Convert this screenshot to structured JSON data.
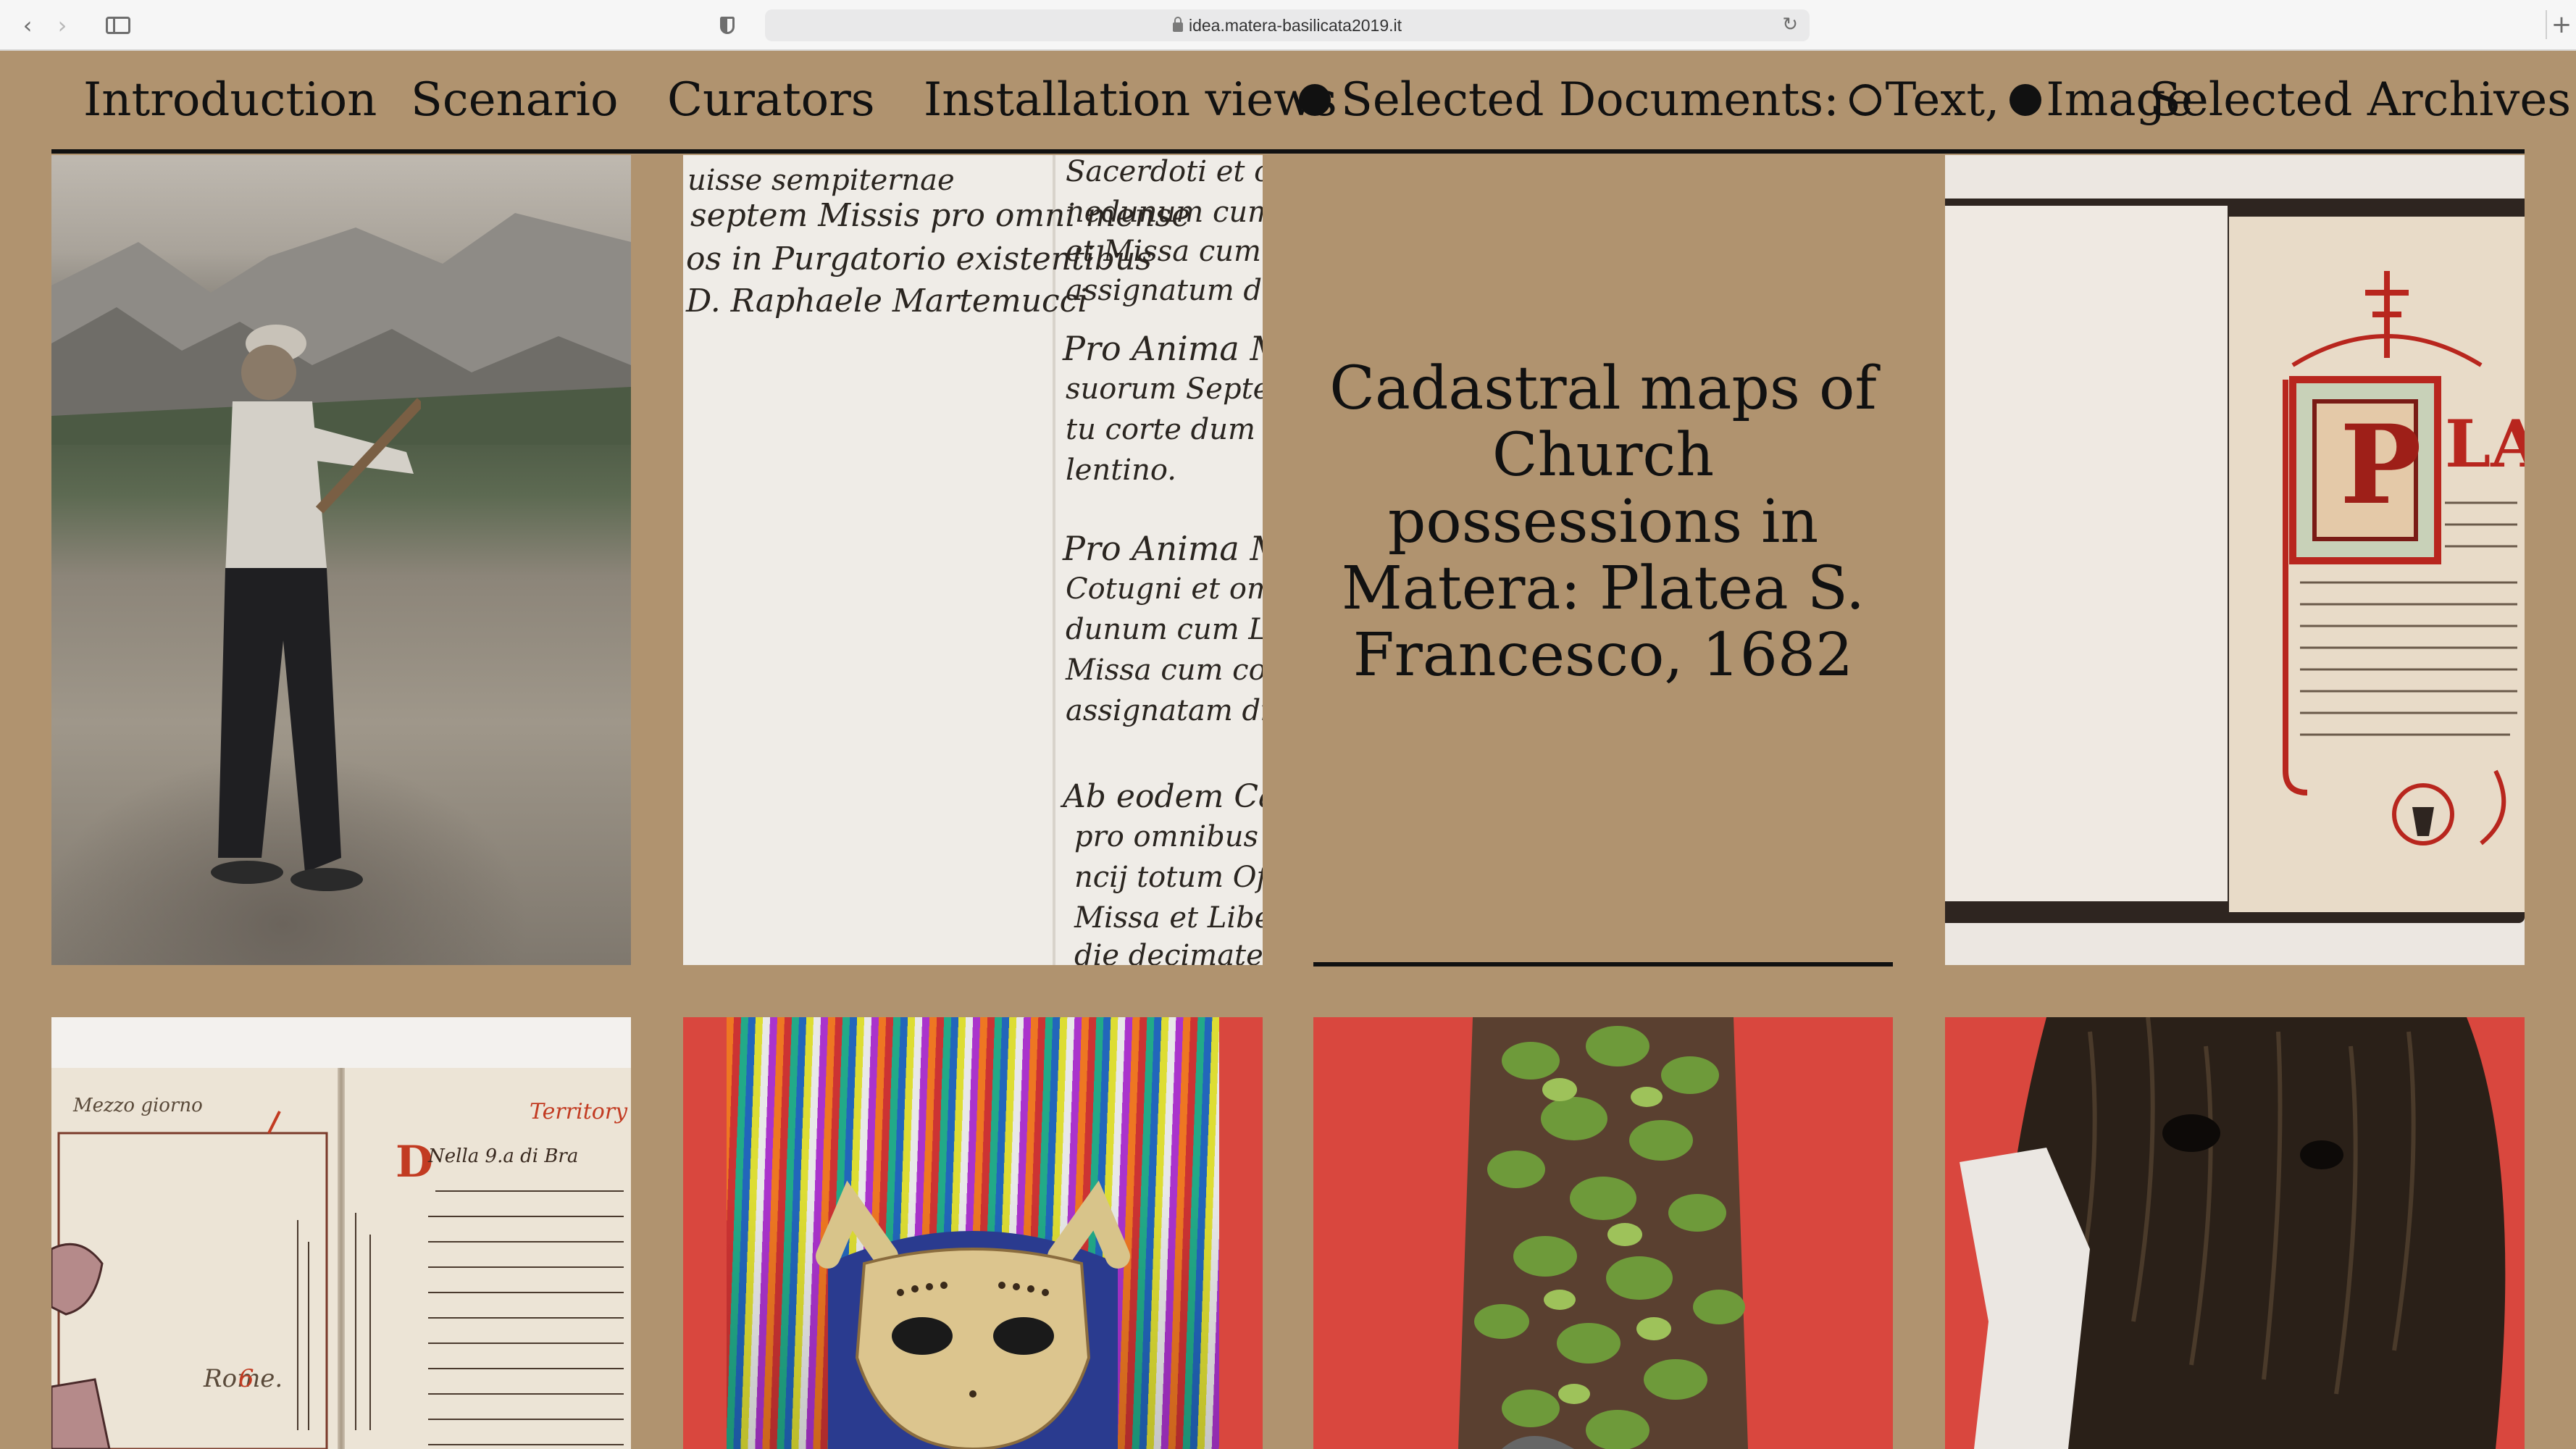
{
  "browser": {
    "url": "idea.matera-basilicata2019.it",
    "icons": [
      "back-arrow-icon",
      "forward-arrow-icon",
      "sidebar-icon",
      "privacy-shield-icon",
      "lock-icon",
      "reload-icon",
      "new-tab-icon"
    ]
  },
  "nav": {
    "introduction": "Introduction",
    "scenario": "Scenario",
    "curators": "Curators",
    "installation_views": "Installation views",
    "selected_documents": "Selected Documents:",
    "text_filter": "Text,",
    "image_filter": "Image",
    "selected_archives": "Selected Archives"
  },
  "grid": {
    "text_tile_caption": "Cadastral maps of Church possessions in Matera: Platea S. Francesco, 1682"
  },
  "colors": {
    "background": "#b0936f",
    "ink": "#111111",
    "red_backdrop": "#d9473e"
  }
}
